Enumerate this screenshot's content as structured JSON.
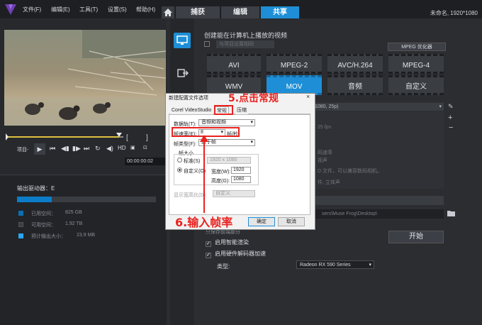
{
  "menu": [
    "文件(F)",
    "编辑(E)",
    "工具(T)",
    "设置(S)",
    "帮助(H)"
  ],
  "tabs": {
    "capture": "捕获",
    "edit": "编辑",
    "share": "共享"
  },
  "project_name": "未命名, 1920*1080",
  "player": {
    "project_label": "项目-",
    "hd_label": "HD",
    "timecode": "00:00:00:02"
  },
  "drive": {
    "label": "输出驱动器：E",
    "used": {
      "label": "已用空间：",
      "value": "825 GB"
    },
    "free": {
      "label": "可用空间：",
      "value": "1.92 TB"
    },
    "estimated": {
      "label": "预计输出大小：",
      "value": "23.9 MB"
    },
    "used_fraction": 0.25
  },
  "share": {
    "heading": "创建能在计算机上播放的视频",
    "project_setting": "与项目设置相同",
    "mpeg_optimizer": "MPEG 优化器",
    "formats_row1": [
      "AVI",
      "MPEG-2",
      "AVC/H.264",
      "MPEG-4"
    ],
    "formats_row2": [
      "WMV",
      "MOV",
      "音频",
      "自定义"
    ],
    "active_format": "MOV",
    "profile_fragment": "1080, 25p)",
    "desc_lines": [
      "25 fps",
      "码速率",
      "视声",
      "D 文件，可以兼容数码相机。",
      "件, 立体声"
    ],
    "path_fragment": "sers\\Muse Frog\\Desktop\\",
    "start_button": "开始",
    "smart_render_partial": "只保存前端部分",
    "smart_render": "启用智能渲染",
    "hw_decode": "启用硬件解码器加速",
    "type_label": "类型:",
    "gpu": "Radeon RX 590 Series"
  },
  "dialog": {
    "title": "新建配置文件选项",
    "close": "×",
    "tabs": [
      "Corel VideoStudio",
      "常规",
      "压缩"
    ],
    "track_label": "数据轨(T):",
    "track_value": "音频和视频",
    "fps_label": "帧速率(E):",
    "fps_value": "8",
    "fps_unit": "帧/秒",
    "frame_type_label": "帧类型(F):",
    "frame_type_value": "基于帧",
    "size_label": "帧大小",
    "standard_label": "标准(S)",
    "standard_value": "1920 x 1080",
    "custom_label": "自定义(O)",
    "width_label": "宽度(W):",
    "width_value": "1920",
    "height_label": "高度(G):",
    "height_value": "1080",
    "aspect_label": "显示宽高比(D):",
    "aspect_value": "自定义",
    "ok": "确定",
    "cancel": "取消"
  },
  "annotations": {
    "step5": "5.点击常规",
    "step6": "6.输入帧率"
  },
  "colors": {
    "accent": "#1e8fd6",
    "annotation": "#e8231f"
  }
}
